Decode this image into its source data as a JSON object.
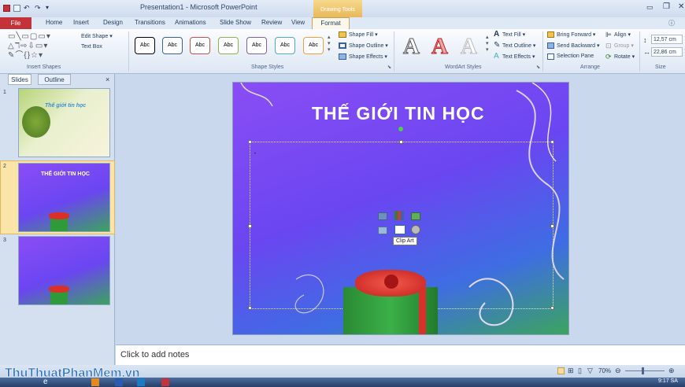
{
  "window": {
    "title": "Presentation1 - Microsoft PowerPoint",
    "contextual_tab": "Drawing Tools"
  },
  "tabs": [
    "File",
    "Home",
    "Insert",
    "Design",
    "Transitions",
    "Animations",
    "Slide Show",
    "Review",
    "View",
    "Format"
  ],
  "ribbon": {
    "insert_shapes": {
      "label": "Insert Shapes",
      "edit_shape": "Edit Shape ▾",
      "text_box": "Text Box"
    },
    "shape_styles": {
      "label": "Shape Styles",
      "sample": "Abc",
      "shape_fill": "Shape Fill ▾",
      "shape_outline": "Shape Outline ▾",
      "shape_effects": "Shape Effects ▾"
    },
    "wordart_styles": {
      "label": "WordArt Styles",
      "sample": "A",
      "text_fill": "Text Fill ▾",
      "text_outline": "Text Outline ▾",
      "text_effects": "Text Effects ▾"
    },
    "arrange": {
      "label": "Arrange",
      "bring_forward": "Bring Forward ▾",
      "send_backward": "Send Backward ▾",
      "selection_pane": "Selection Pane",
      "align": "Align ▾",
      "group": "Group ▾",
      "rotate": "Rotate ▾"
    },
    "size": {
      "label": "Size",
      "height": "12,57 cm",
      "width": "22,86 cm"
    }
  },
  "left_pane": {
    "tabs": [
      "Slides",
      "Outline"
    ],
    "close": "×",
    "thumbs": [
      {
        "num": "1",
        "title": "Thế giới tin học"
      },
      {
        "num": "2",
        "title": "THẾ GIỚI TIN HỌC"
      },
      {
        "num": "3",
        "title": ""
      }
    ]
  },
  "slide": {
    "title": "THẾ GIỚI TIN HỌC",
    "tooltip": "Clip Art"
  },
  "notes": {
    "placeholder": "Click to add notes"
  },
  "status": {
    "zoom": "70%"
  },
  "taskbar": {
    "clock": "9:17 SA",
    "watermark": "ThuThuatPhanMem.vn"
  },
  "colors": {
    "file_tab": "#c4323a",
    "ribbon_bg": "#dde7f4",
    "slide_purple": "#7b48f3",
    "gift_green": "#2f9a3a",
    "ribbon_red": "#d9302a"
  }
}
